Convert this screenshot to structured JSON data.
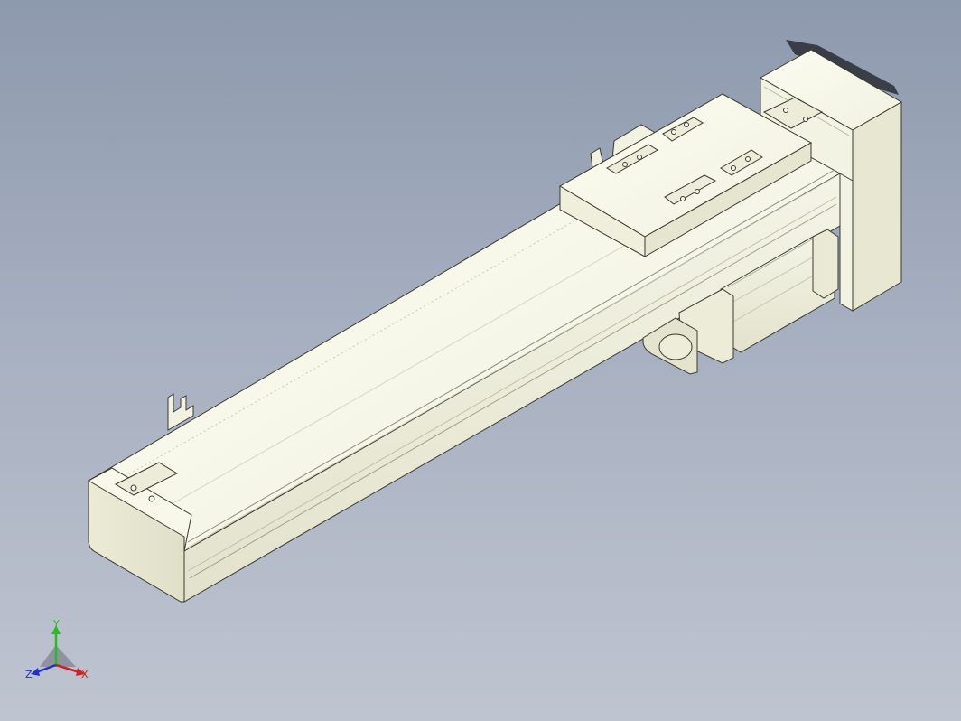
{
  "viewport": {
    "background_top": "#8d99ad",
    "background_bottom": "#bfc4d0"
  },
  "model": {
    "part_color": "#f0f0dc",
    "part_shade_light": "#fafaf0",
    "part_shade_mid": "#e6e6d0",
    "part_shade_dark": "#d8d8c0",
    "edge_color": "#3a3a32"
  },
  "triad": {
    "x_label": "X",
    "y_label": "Y",
    "z_label": "Z",
    "x_color": "#d02020",
    "y_color": "#20c020",
    "z_color": "#2030d0"
  }
}
